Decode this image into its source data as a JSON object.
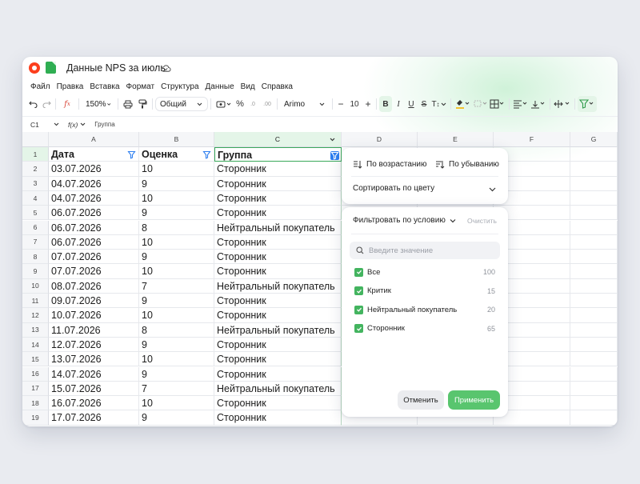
{
  "app": {
    "doc_title": "Данные NPS за июль"
  },
  "menu": [
    "Файл",
    "Правка",
    "Вставка",
    "Формат",
    "Структура",
    "Данные",
    "Вид",
    "Справка"
  ],
  "toolbar": {
    "zoom": "150%",
    "number_format": "Общий",
    "percent": "%",
    "decimals_dec": ".0",
    "decimals_inc": ".00",
    "font": "Arimo",
    "font_size": "10",
    "bold": "B",
    "italic": "I",
    "underline": "U",
    "strike": "S",
    "text_size": "T"
  },
  "formula_bar": {
    "cell": "C1",
    "fx": "f(x)",
    "value": "Группа"
  },
  "columns": [
    "A",
    "B",
    "C",
    "D",
    "E",
    "F",
    "G"
  ],
  "sheet": {
    "header": [
      "Дата",
      "Оценка",
      "Группа"
    ],
    "rows": [
      [
        "03.07.2026",
        "10",
        "Сторонник"
      ],
      [
        "04.07.2026",
        "9",
        "Сторонник"
      ],
      [
        "04.07.2026",
        "10",
        "Сторонник"
      ],
      [
        "06.07.2026",
        "9",
        "Сторонник"
      ],
      [
        "06.07.2026",
        "8",
        "Нейтральный покупатель"
      ],
      [
        "06.07.2026",
        "10",
        "Сторонник"
      ],
      [
        "07.07.2026",
        "9",
        "Сторонник"
      ],
      [
        "07.07.2026",
        "10",
        "Сторонник"
      ],
      [
        "08.07.2026",
        "7",
        "Нейтральный покупатель"
      ],
      [
        "09.07.2026",
        "9",
        "Сторонник"
      ],
      [
        "10.07.2026",
        "10",
        "Сторонник"
      ],
      [
        "11.07.2026",
        "8",
        "Нейтральный покупатель"
      ],
      [
        "12.07.2026",
        "9",
        "Сторонник"
      ],
      [
        "13.07.2026",
        "10",
        "Сторонник"
      ],
      [
        "14.07.2026",
        "9",
        "Сторонник"
      ],
      [
        "15.07.2026",
        "7",
        "Нейтральный покупатель"
      ],
      [
        "16.07.2026",
        "10",
        "Сторонник"
      ],
      [
        "17.07.2026",
        "9",
        "Сторонник"
      ]
    ]
  },
  "sort_panel": {
    "ascending": "По возрастанию",
    "descending": "По убыванию",
    "by_color": "Сортировать по цвету"
  },
  "filter_panel": {
    "condition": "Фильтровать по условию",
    "clear": "Очистить",
    "search_placeholder": "Введите значение",
    "options": [
      {
        "label": "Все",
        "count": "100"
      },
      {
        "label": "Критик",
        "count": "15"
      },
      {
        "label": "Нейтральный покупатель",
        "count": "20"
      },
      {
        "label": "Сторонник",
        "count": "65"
      }
    ],
    "cancel": "Отменить",
    "apply": "Применить"
  },
  "colors": {
    "accent": "#59c56e",
    "checkbox": "#43b45f",
    "filter_active": "#2e7ff0",
    "selected_header": "#e4f5e8"
  }
}
